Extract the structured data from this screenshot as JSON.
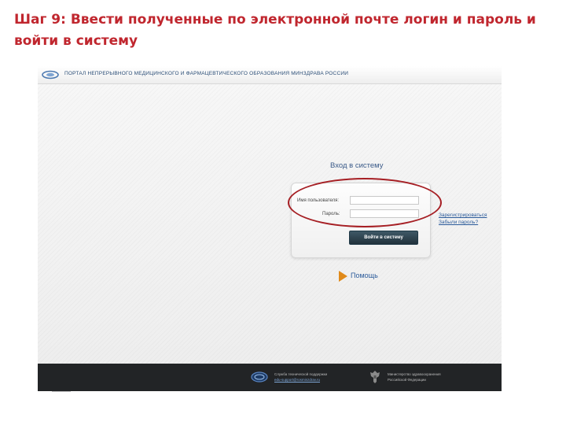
{
  "slide": {
    "title": "Шаг 9: Ввести полученные по электронной почте логин и пароль и войти в систему"
  },
  "portal": {
    "header_title": "ПОРТАЛ НЕПРЕРЫВНОГО МЕДИЦИНСКОГО И ФАРМАЦЕВТИЧЕСКОГО ОБРАЗОВАНИЯ МИНЗДРАВА РОССИИ",
    "login": {
      "heading": "Вход в систему",
      "username_label": "Имя пользователя:",
      "username_value": "",
      "password_label": "Пароль:",
      "password_value": "",
      "submit_label": "Войти в систему"
    },
    "links": {
      "register": "Зарегистрироваться",
      "forgot_password": "Забыли пароль?"
    },
    "help": "Помощь",
    "footer": {
      "support_title": "Служба технической поддержки",
      "support_email": "edu-support@rosminzdrav.ru",
      "ministry_line1": "Министерство здравоохранения",
      "ministry_line2": "Российской Федерации"
    }
  },
  "colors": {
    "title_red": "#c0262e",
    "annotation_red": "#a61f24",
    "link_blue": "#2a5a9a",
    "button_dark": "#2c424e",
    "footer_dark": "#222426",
    "help_arrow": "#e08a1a"
  },
  "icons": {
    "portal_logo": "portal-logo-icon",
    "help_arrow": "play-arrow-icon",
    "footer_emblem": "portal-emblem-icon",
    "ministry_crest": "double-headed-eagle-icon"
  }
}
